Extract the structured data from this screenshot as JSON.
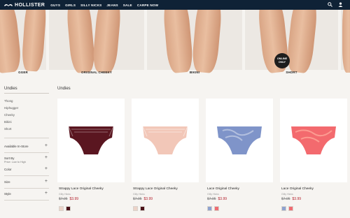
{
  "nav": {
    "brand": "HOLLISTER",
    "links": [
      "GUYS",
      "GIRLS",
      "SILLY NICKS",
      "JEANS",
      "SALE",
      "CARPE NOW"
    ],
    "icons": [
      "search-icon",
      "account-icon"
    ]
  },
  "hero": {
    "tiles": [
      {
        "caption": "GGER"
      },
      {
        "caption": "ORIGINAL CHEEKY"
      },
      {
        "caption": "BIKINI"
      },
      {
        "caption": "SHORT",
        "badge": [
          "ONLINE",
          "ONLY"
        ]
      }
    ]
  },
  "sidebar": {
    "title": "Undies",
    "links": [
      "Thong",
      "Hiphugger",
      "Cheeky",
      "Bikini",
      "Short"
    ],
    "filters": [
      {
        "label": "Available In-Store",
        "sub": ""
      },
      {
        "label": "Sort By",
        "sub": "Price: Low to High"
      },
      {
        "label": "Color",
        "sub": ""
      },
      {
        "label": "Size",
        "sub": ""
      },
      {
        "label": "Style",
        "sub": ""
      }
    ]
  },
  "main": {
    "title": "Undies",
    "products": [
      {
        "name": "Strappy Lace Original Cheeky",
        "brand": "Gilly Hicks",
        "old_price": "$7.95",
        "price": "$3.99",
        "color": "#5a1620",
        "swatches": [
          "#ecd3c8",
          "#4b1219"
        ]
      },
      {
        "name": "Strappy Lace Original Cheeky",
        "brand": "Gilly Hicks",
        "old_price": "$7.95",
        "price": "$3.99",
        "color": "#f2c7b8",
        "swatches": [
          "#ecd3c8",
          "#4b1219"
        ]
      },
      {
        "name": "Lace Original Cheeky",
        "brand": "Gilly Hicks",
        "old_price": "$7.95",
        "price": "$3.99",
        "color": "#7f94c9",
        "swatches": [
          "#8fa2cf",
          "#ef6c72"
        ]
      },
      {
        "name": "Lace Original Cheeky",
        "brand": "Gilly Hicks",
        "old_price": "$7.95",
        "price": "$3.99",
        "color": "#f36a6e",
        "swatches": [
          "#8fa2cf",
          "#ef6c72"
        ]
      }
    ]
  }
}
